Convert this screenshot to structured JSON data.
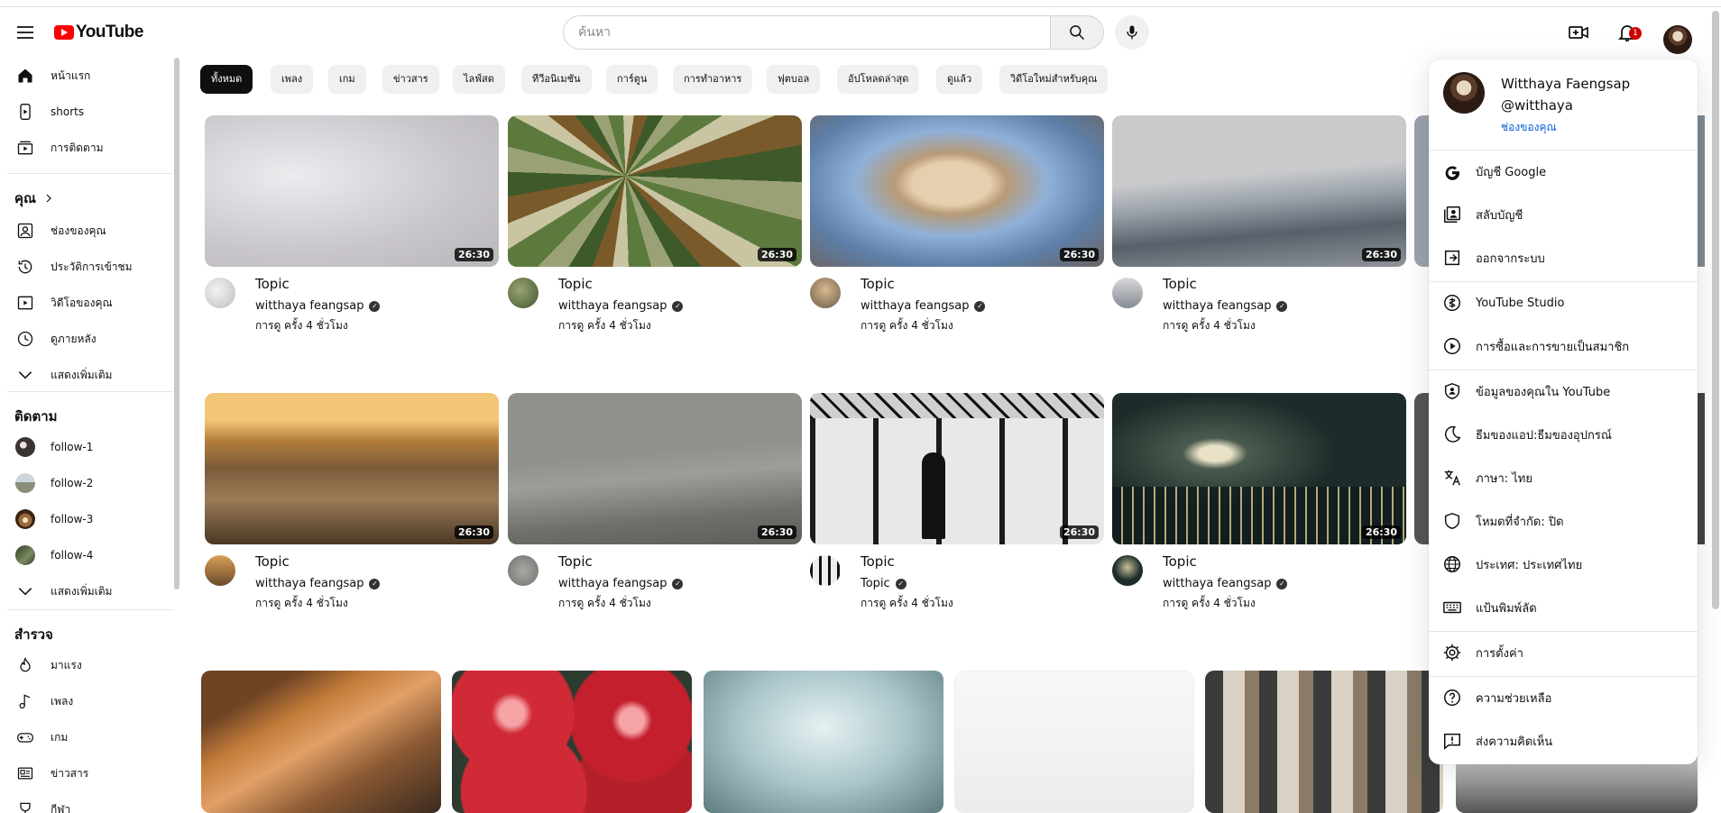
{
  "header": {
    "logo_text": "YouTube",
    "search_placeholder": "ค้นหา",
    "notifications_count": "1"
  },
  "sidebar": {
    "main": [
      {
        "label": "หน้าแรก",
        "icon": "home-icon"
      },
      {
        "label": "shorts",
        "icon": "shorts-icon"
      },
      {
        "label": "การติดตาม",
        "icon": "subscriptions-icon"
      }
    ],
    "you_heading": "คุณ",
    "you": [
      {
        "label": "ช่องของคุณ",
        "icon": "channel-icon"
      },
      {
        "label": "ประวัติการเข้าชม",
        "icon": "history-icon"
      },
      {
        "label": "วิดีโอของคุณ",
        "icon": "your-videos-icon"
      },
      {
        "label": "ดูภายหลัง",
        "icon": "watch-later-icon"
      },
      {
        "label": "แสดงเพิ่มเติม",
        "icon": "chevron-down-icon"
      }
    ],
    "subs_heading": "ติดตาม",
    "subs": [
      {
        "label": "follow-1"
      },
      {
        "label": "follow-2"
      },
      {
        "label": "follow-3"
      },
      {
        "label": "follow-4"
      },
      {
        "label": "แสดงเพิ่มเติม"
      }
    ],
    "explore_heading": "สำรวจ",
    "explore": [
      {
        "label": "มาแรง",
        "icon": "trending-icon"
      },
      {
        "label": "เพลง",
        "icon": "music-icon"
      },
      {
        "label": "เกม",
        "icon": "gaming-icon"
      },
      {
        "label": "ข่าวสาร",
        "icon": "news-icon"
      },
      {
        "label": "กีฬา",
        "icon": "sports-icon"
      }
    ]
  },
  "chips": [
    "ทั้งหมด",
    "เพลง",
    "เกม",
    "ข่าวสาร",
    "ไลฟ์สด",
    "ทีวีอนิเมชัน",
    "การ์ตูน",
    "การทำอาหาร",
    "ฟุตบอล",
    "อัปโหลดล่าสุด",
    "ดูแล้ว",
    "วิดีโอใหม่สำหรับคุณ"
  ],
  "videos": [
    {
      "title": "Topic",
      "channel": "witthaya feangsap",
      "stats": "การดู ครั้ง 4 ชั่วโมง",
      "duration": "26:30"
    },
    {
      "title": "Topic",
      "channel": "witthaya feangsap",
      "stats": "การดู ครั้ง 4 ชั่วโมง",
      "duration": "26:30"
    },
    {
      "title": "Topic",
      "channel": "witthaya feangsap",
      "stats": "การดู ครั้ง 4 ชั่วโมง",
      "duration": "26:30"
    },
    {
      "title": "Topic",
      "channel": "witthaya feangsap",
      "stats": "การดู ครั้ง 4 ชั่วโมง",
      "duration": "26:30"
    },
    {
      "title": "Topic",
      "channel": "witthaya feangsap",
      "stats": "การดู ครั้ง 4 ชั่วโมง",
      "duration": "26:30"
    },
    {
      "title": "Topic",
      "channel": "witthaya feangsap",
      "stats": "การดู ครั้ง 4 ชั่วโมง",
      "duration": "26:30"
    },
    {
      "title": "Topic",
      "channel": "Topic",
      "stats": "การดู ครั้ง 4 ชั่วโมง",
      "duration": "26:30"
    },
    {
      "title": "Topic",
      "channel": "witthaya feangsap",
      "stats": "การดู ครั้ง 4 ชั่วโมง",
      "duration": "26:30"
    }
  ],
  "account_menu": {
    "name": "Witthaya Faengsap",
    "handle": "@witthaya",
    "channel_link": "ช่องของคุณ",
    "items": [
      {
        "label": "บัญชี Google",
        "icon": "google-icon"
      },
      {
        "label": "สลับบัญชี",
        "icon": "switch-account-icon"
      },
      {
        "label": "ออกจากระบบ",
        "icon": "sign-out-icon"
      },
      {
        "label": "YouTube Studio",
        "icon": "studio-icon"
      },
      {
        "label": "การซื้อและการขายเป็นสมาชิก",
        "icon": "purchases-icon"
      },
      {
        "label": "ข้อมูลของคุณใน YouTube",
        "icon": "your-data-icon"
      },
      {
        "label": "ธีมของแอป:ธีมของอุปกรณ์",
        "icon": "theme-moon-icon"
      },
      {
        "label": "ภาษา: ไทย",
        "icon": "language-icon"
      },
      {
        "label": "โหมดที่จำกัด: ปิด",
        "icon": "restricted-mode-icon"
      },
      {
        "label": "ประเทศ: ประเทศไทย",
        "icon": "globe-icon"
      },
      {
        "label": "แป้นพิมพ์ลัด",
        "icon": "keyboard-icon"
      },
      {
        "label": "การตั้งค่า",
        "icon": "settings-gear-icon"
      },
      {
        "label": "ความช่วยเหลือ",
        "icon": "help-icon"
      },
      {
        "label": "ส่งความคิดเห็น",
        "icon": "feedback-icon"
      }
    ]
  }
}
